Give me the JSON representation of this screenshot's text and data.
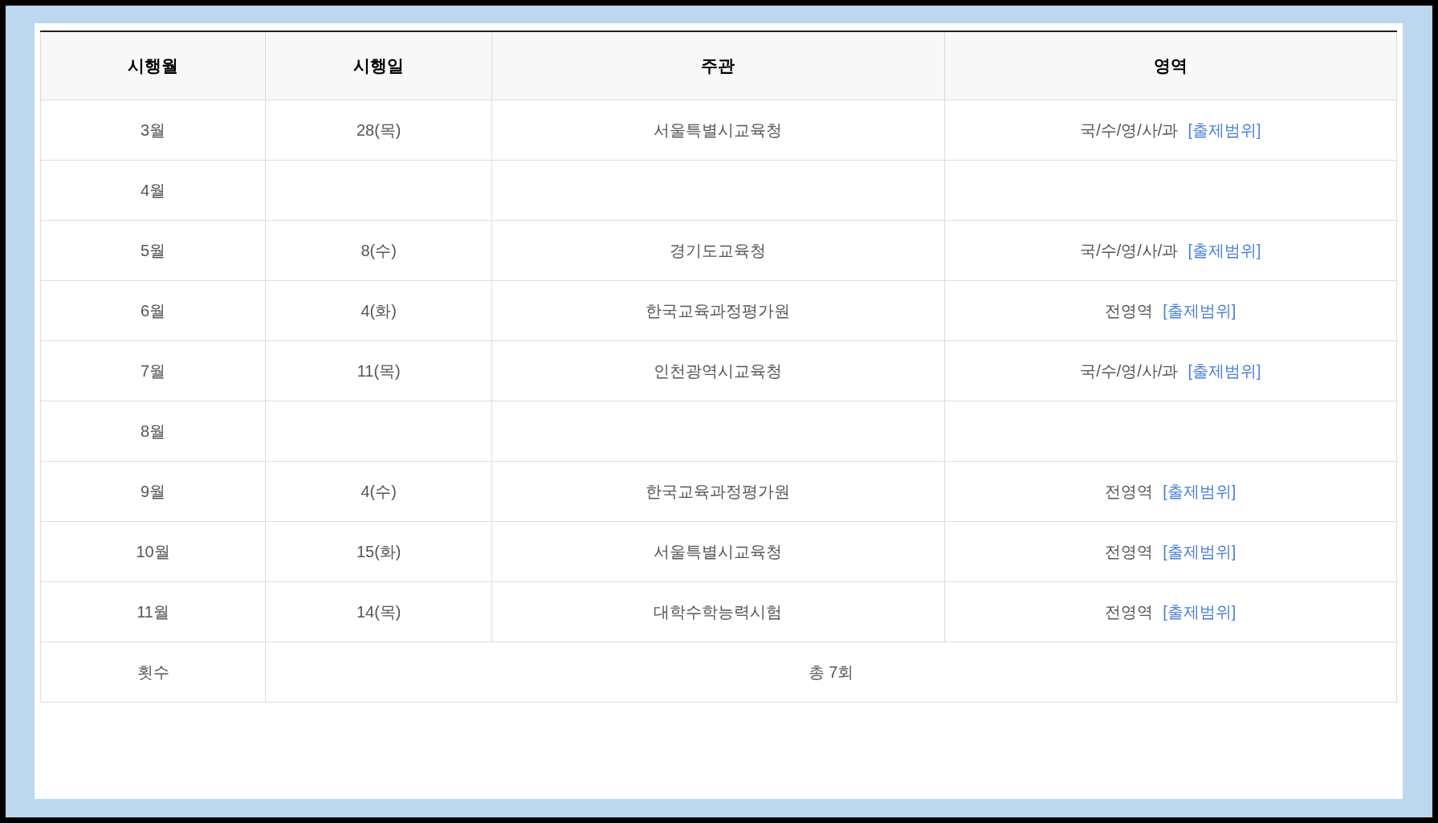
{
  "table": {
    "columns": [
      "시행월",
      "시행일",
      "주관",
      "영역"
    ],
    "rows": [
      {
        "month": "3월",
        "day": "28(목)",
        "host": "서울특별시교육청",
        "area": "국/수/영/사/과",
        "link": "[출제범위]"
      },
      {
        "month": "4월"
      },
      {
        "month": "5월",
        "day": "8(수)",
        "host": "경기도교육청",
        "area": "국/수/영/사/과",
        "link": "[출제범위]"
      },
      {
        "month": "6월",
        "day": "4(화)",
        "host": "한국교육과정평가원",
        "area": "전영역",
        "link": "[출제범위]"
      },
      {
        "month": "7월",
        "day": "11(목)",
        "host": "인천광역시교육청",
        "area": "국/수/영/사/과",
        "link": "[출제범위]"
      },
      {
        "month": "8월"
      },
      {
        "month": "9월",
        "day": "4(수)",
        "host": "한국교육과정평가원",
        "area": "전영역",
        "link": "[출제범위]"
      },
      {
        "month": "10월",
        "day": "15(화)",
        "host": "서울특별시교육청",
        "area": "전영역",
        "link": "[출제범위]"
      },
      {
        "month": "11월",
        "day": "14(목)",
        "host": "대학수학능력시험",
        "area": "전영역",
        "link": "[출제범위]"
      }
    ],
    "footer": {
      "label": "횟수",
      "value": "총 7회"
    }
  }
}
